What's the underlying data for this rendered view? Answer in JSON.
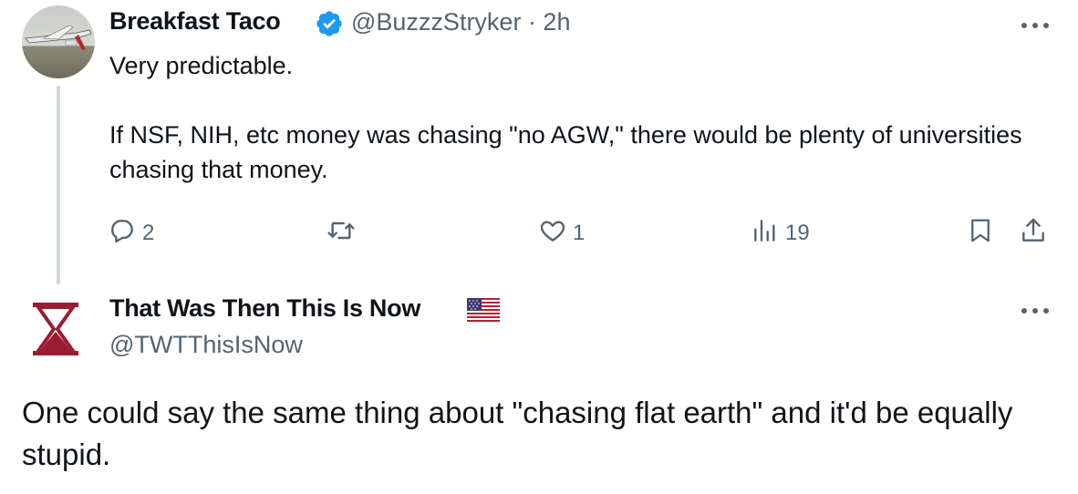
{
  "tweet1": {
    "author_name": "Breakfast Taco",
    "handle_time": "@BuzzzStryker · 2h",
    "body_line1": "Very predictable.",
    "body_line2": "If NSF, NIH, etc money was chasing \"no AGW,\" there would be plenty of universities chasing that money.",
    "reply_count": "2",
    "retweet_count": "",
    "like_count": "1",
    "view_count": "19"
  },
  "tweet2": {
    "author_name": "That Was Then This Is Now",
    "handle": "@TWTThisIsNow",
    "body": "One could say the same thing about \"chasing flat earth\" and it'd be equally stupid."
  },
  "colors": {
    "text": "#0f1419",
    "secondary": "#536471",
    "verified": "#1d9bf0",
    "thread_line": "#cfd9de",
    "hourglass": "#9b1b30"
  },
  "icons": [
    "reply-icon",
    "retweet-icon",
    "like-icon",
    "views-icon",
    "bookmark-icon",
    "share-icon",
    "more-icon",
    "verified-badge-icon",
    "us-flag-icon",
    "hourglass-icon"
  ]
}
